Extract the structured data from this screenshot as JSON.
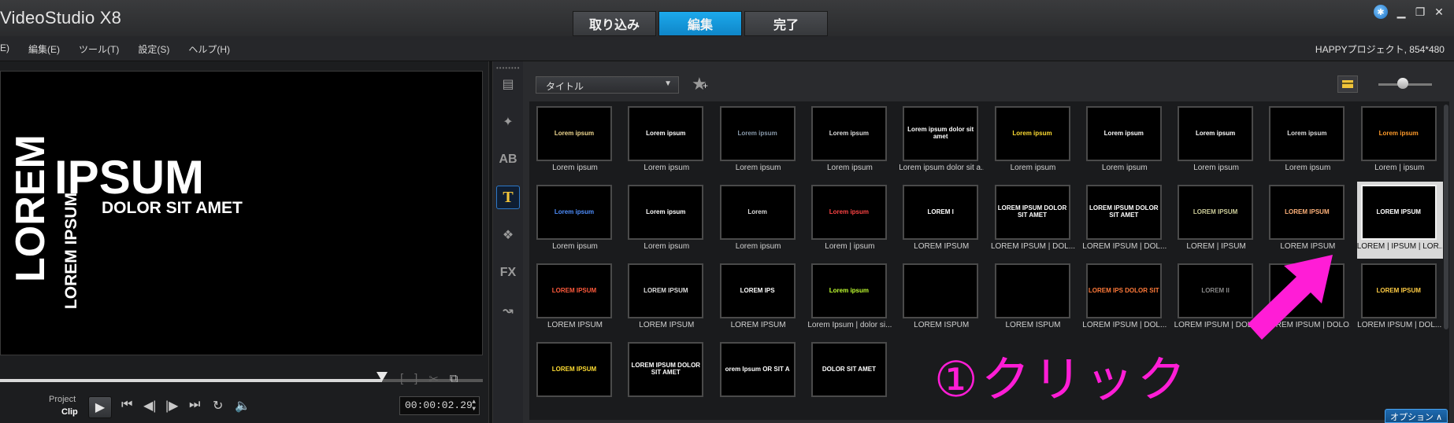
{
  "app": {
    "title": "VideoStudio X8"
  },
  "tabs": [
    {
      "label": "取り込み",
      "active": false
    },
    {
      "label": "編集",
      "active": true
    },
    {
      "label": "完了",
      "active": false
    }
  ],
  "menu": [
    "E)",
    "編集(E)",
    "ツール(T)",
    "設定(S)",
    "ヘルプ(H)"
  ],
  "project_info": "HAPPYプロジェクト, 854*480",
  "preview": {
    "line_vertical_big": "LOREM",
    "line_vertical_small": "LOREM IPSUM",
    "line_main": "IPSUM",
    "line_sub": "DOLOR SIT AMET"
  },
  "playback": {
    "progress": 0.79,
    "project_label": "Project",
    "clip_label": "Clip",
    "timecode": "00:00:02.29"
  },
  "library": {
    "category": "タイトル",
    "items": [
      {
        "caption": "Lorem ipsum",
        "thumb": "Lorem ipsum",
        "color": "#f0d890"
      },
      {
        "caption": "Lorem ipsum",
        "thumb": "Lorem ipsum",
        "color": "#ffffff"
      },
      {
        "caption": "Lorem ipsum",
        "thumb": "Lorem ipsum",
        "color": "#8899aa"
      },
      {
        "caption": "Lorem ipsum",
        "thumb": "Lorem ipsum",
        "color": "#dddddd"
      },
      {
        "caption": "Lorem ipsum dolor sit a...",
        "thumb": "Lorem ipsum dolor sit amet",
        "color": "#ffffff"
      },
      {
        "caption": "Lorem ipsum",
        "thumb": "Lorem ipsum",
        "color": "#ffdd33"
      },
      {
        "caption": "Lorem ipsum",
        "thumb": "Lorem ipsum",
        "color": "#ffffff"
      },
      {
        "caption": "Lorem ipsum",
        "thumb": "Lorem ipsum",
        "color": "#ffffff"
      },
      {
        "caption": "Lorem ipsum",
        "thumb": "Lorem ipsum",
        "color": "#dddddd"
      },
      {
        "caption": "Lorem | ipsum",
        "thumb": "Lorem ipsum",
        "color": "#ff9a2a"
      },
      {
        "caption": "Lorem ipsum",
        "thumb": "Lorem ipsum",
        "color": "#4f8fff"
      },
      {
        "caption": "Lorem ipsum",
        "thumb": "Lorem ipsum",
        "color": "#ffffff"
      },
      {
        "caption": "Lorem ipsum",
        "thumb": "Lorem",
        "color": "#dddddd"
      },
      {
        "caption": "Lorem | ipsum",
        "thumb": "Lorem ipsum",
        "color": "#ff4444"
      },
      {
        "caption": "LOREM IPSUM",
        "thumb": "LOREM I",
        "color": "#ffffff"
      },
      {
        "caption": "LOREM IPSUM | DOL...",
        "thumb": "LOREM IPSUM DOLOR SIT AMET",
        "color": "#ffffff"
      },
      {
        "caption": "LOREM IPSUM | DOL...",
        "thumb": "LOREM IPSUM DOLOR SIT AMET",
        "color": "#ffffff"
      },
      {
        "caption": "LOREM | IPSUM",
        "thumb": "LOREM IPSUM",
        "color": "#cccc99"
      },
      {
        "caption": "LOREM IPSUM",
        "thumb": "LOREM IPSUM",
        "color": "#ffb27a"
      },
      {
        "caption": "LOREM | IPSUM | LOR...",
        "thumb": "LOREM IPSUM",
        "color": "#ffffff",
        "selected": true
      },
      {
        "caption": "LOREM IPSUM",
        "thumb": "LOREM IPSUM",
        "color": "#ff5a3c"
      },
      {
        "caption": "LOREM IPSUM",
        "thumb": "LOREM IPSUM",
        "color": "#dddddd"
      },
      {
        "caption": "LOREM IPSUM",
        "thumb": "LOREM IPS",
        "color": "#ffffff"
      },
      {
        "caption": "Lorem Ipsum | dolor si...",
        "thumb": "Lorem ipsum",
        "color": "#c0ff30"
      },
      {
        "caption": "LOREM ISPUM",
        "thumb": "",
        "color": "#ffffff"
      },
      {
        "caption": "LOREM ISPUM",
        "thumb": "",
        "color": "#ffffff"
      },
      {
        "caption": "LOREM IPSUM | DOL...",
        "thumb": "LOREM IPS DOLOR SIT",
        "color": "#ff7a3a"
      },
      {
        "caption": "LOREM IPSUM | DOL...",
        "thumb": "LOREM II",
        "color": "#888888"
      },
      {
        "caption": "LOREM IPSUM | DOLO...",
        "thumb": "LOREM",
        "color": "#ffffff"
      },
      {
        "caption": "LOREM IPSUM | DOL...",
        "thumb": "LOREM IPSUM",
        "color": "#ffcc44"
      },
      {
        "caption": "",
        "thumb": "LOREM IPSUM",
        "color": "#ffdd33"
      },
      {
        "caption": "",
        "thumb": "LOREM IPSUM DOLOR SIT AMET",
        "color": "#ffffff"
      },
      {
        "caption": "",
        "thumb": "orem Ipsum OR SIT A",
        "color": "#ffffff"
      },
      {
        "caption": "",
        "thumb": "DOLOR SIT AMET",
        "color": "#ffffff"
      }
    ]
  },
  "annotation": {
    "text": "①クリック",
    "color": "#ff1dd6"
  },
  "options_button": "オプション ∧",
  "icons": {
    "strip": [
      "media-icon",
      "instant-project-icon",
      "transition-icon",
      "title-icon",
      "graphic-icon",
      "filter-icon",
      "path-icon"
    ]
  }
}
